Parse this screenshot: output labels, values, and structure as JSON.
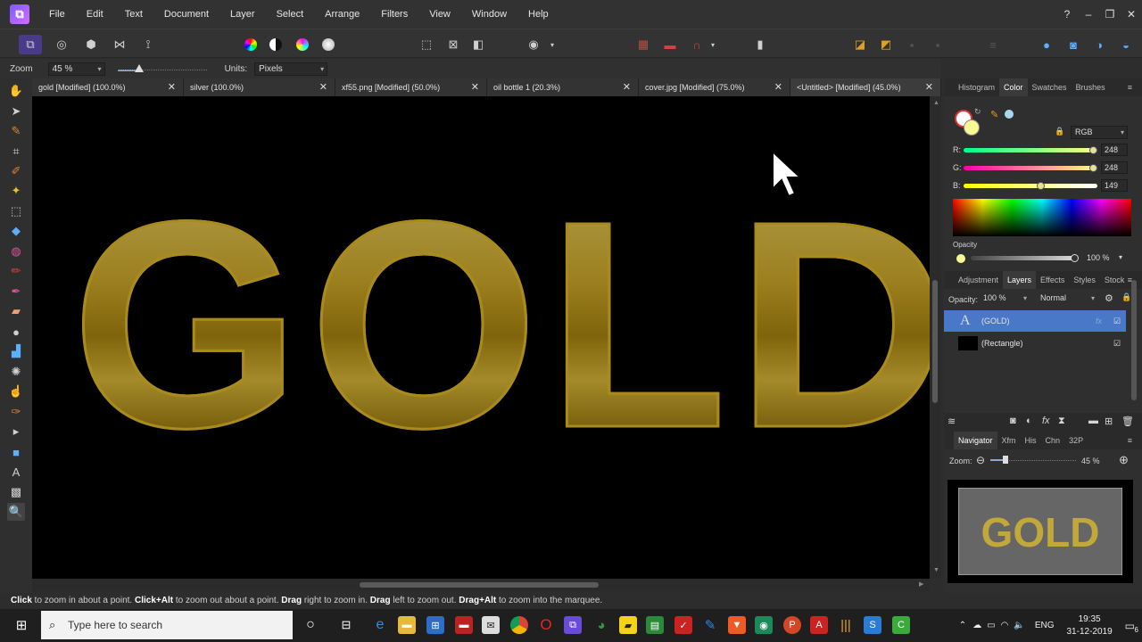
{
  "app": {
    "menu": [
      "File",
      "Edit",
      "Text",
      "Document",
      "Layer",
      "Select",
      "Arrange",
      "Filters",
      "View",
      "Window",
      "Help"
    ],
    "window_controls": [
      "?",
      "–",
      "❐",
      "✕"
    ]
  },
  "context": {
    "zoom_label": "Zoom",
    "zoom_value": "45 %",
    "units_label": "Units:",
    "units_value": "Pixels"
  },
  "tabs": [
    {
      "label": "gold [Modified] (100.0%)"
    },
    {
      "label": "silver (100.0%)"
    },
    {
      "label": "xf55.png [Modified] (50.0%)"
    },
    {
      "label": "oil bottle 1 (20.3%)"
    },
    {
      "label": "cover.jpg [Modified] (75.0%)"
    },
    {
      "label": "<Untitled> [Modified] (45.0%)"
    }
  ],
  "canvas": {
    "text": "GOLD",
    "color_accent": "#d8bd44"
  },
  "status": {
    "s1": "Click",
    "s2": " to zoom in about a point. ",
    "s3": "Click+Alt",
    "s4": " to zoom out about a point. ",
    "s5": "Drag",
    "s6": " right to zoom in. ",
    "s7": "Drag",
    "s8": " left to zoom out. ",
    "s9": "Drag+Alt",
    "s10": " to zoom into the marquee."
  },
  "color_panel": {
    "tabs": [
      "Histogram",
      "Color",
      "Swatches",
      "Brushes"
    ],
    "mode": "RGB",
    "r_label": "R:",
    "r": "248",
    "g_label": "G:",
    "g": "248",
    "b_label": "B:",
    "b": "149",
    "r_fraction": 0.97,
    "g_fraction": 0.97,
    "b_fraction": 0.58,
    "opacity_label": "Opacity",
    "opacity_value": "100 %",
    "swatch_color": "#f8f895"
  },
  "layers_panel": {
    "tabs": [
      "Adjustment",
      "Layers",
      "Effects",
      "Styles",
      "Stock"
    ],
    "opacity_label": "Opacity:",
    "opacity_value": "100 %",
    "blend_mode": "Normal",
    "items": [
      {
        "name": "(GOLD)",
        "icon": "A"
      },
      {
        "name": "(Rectangle)",
        "icon": ""
      }
    ]
  },
  "navigator": {
    "tabs": [
      "Navigator",
      "Xfm",
      "His",
      "Chn",
      "32P"
    ],
    "zoom_label": "Zoom:",
    "zoom_value": "45 %",
    "preview_text": "GOLD"
  },
  "taskbar": {
    "search_placeholder": "Type here to search",
    "lang": "ENG",
    "time": "19:35",
    "date": "31-12-2019",
    "notif_count": "6"
  }
}
